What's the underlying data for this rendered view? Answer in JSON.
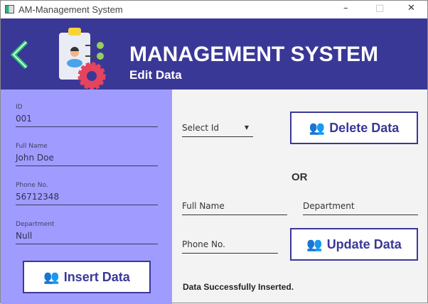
{
  "window": {
    "title": "AM-Management System"
  },
  "header": {
    "title": "MANAGEMENT SYSTEM",
    "subtitle": "Edit Data"
  },
  "form": {
    "id": {
      "label": "ID",
      "value": "001"
    },
    "full_name": {
      "label": "Full Name",
      "value": "John Doe"
    },
    "phone": {
      "label": "Phone No.",
      "value": "56712348"
    },
    "department": {
      "label": "Department",
      "value": "Null"
    },
    "insert_label": "Insert Data"
  },
  "edit": {
    "select_id": "Select Id",
    "delete_label": "Delete Data",
    "or": "OR",
    "full_name_placeholder": "Full Name",
    "department_placeholder": "Department",
    "phone_placeholder": "Phone No.",
    "update_label": "Update Data",
    "status": "Data Successfully Inserted."
  },
  "colors": {
    "header": "#3a3897",
    "panel": "#a09cff",
    "back": "#2ecc71"
  }
}
